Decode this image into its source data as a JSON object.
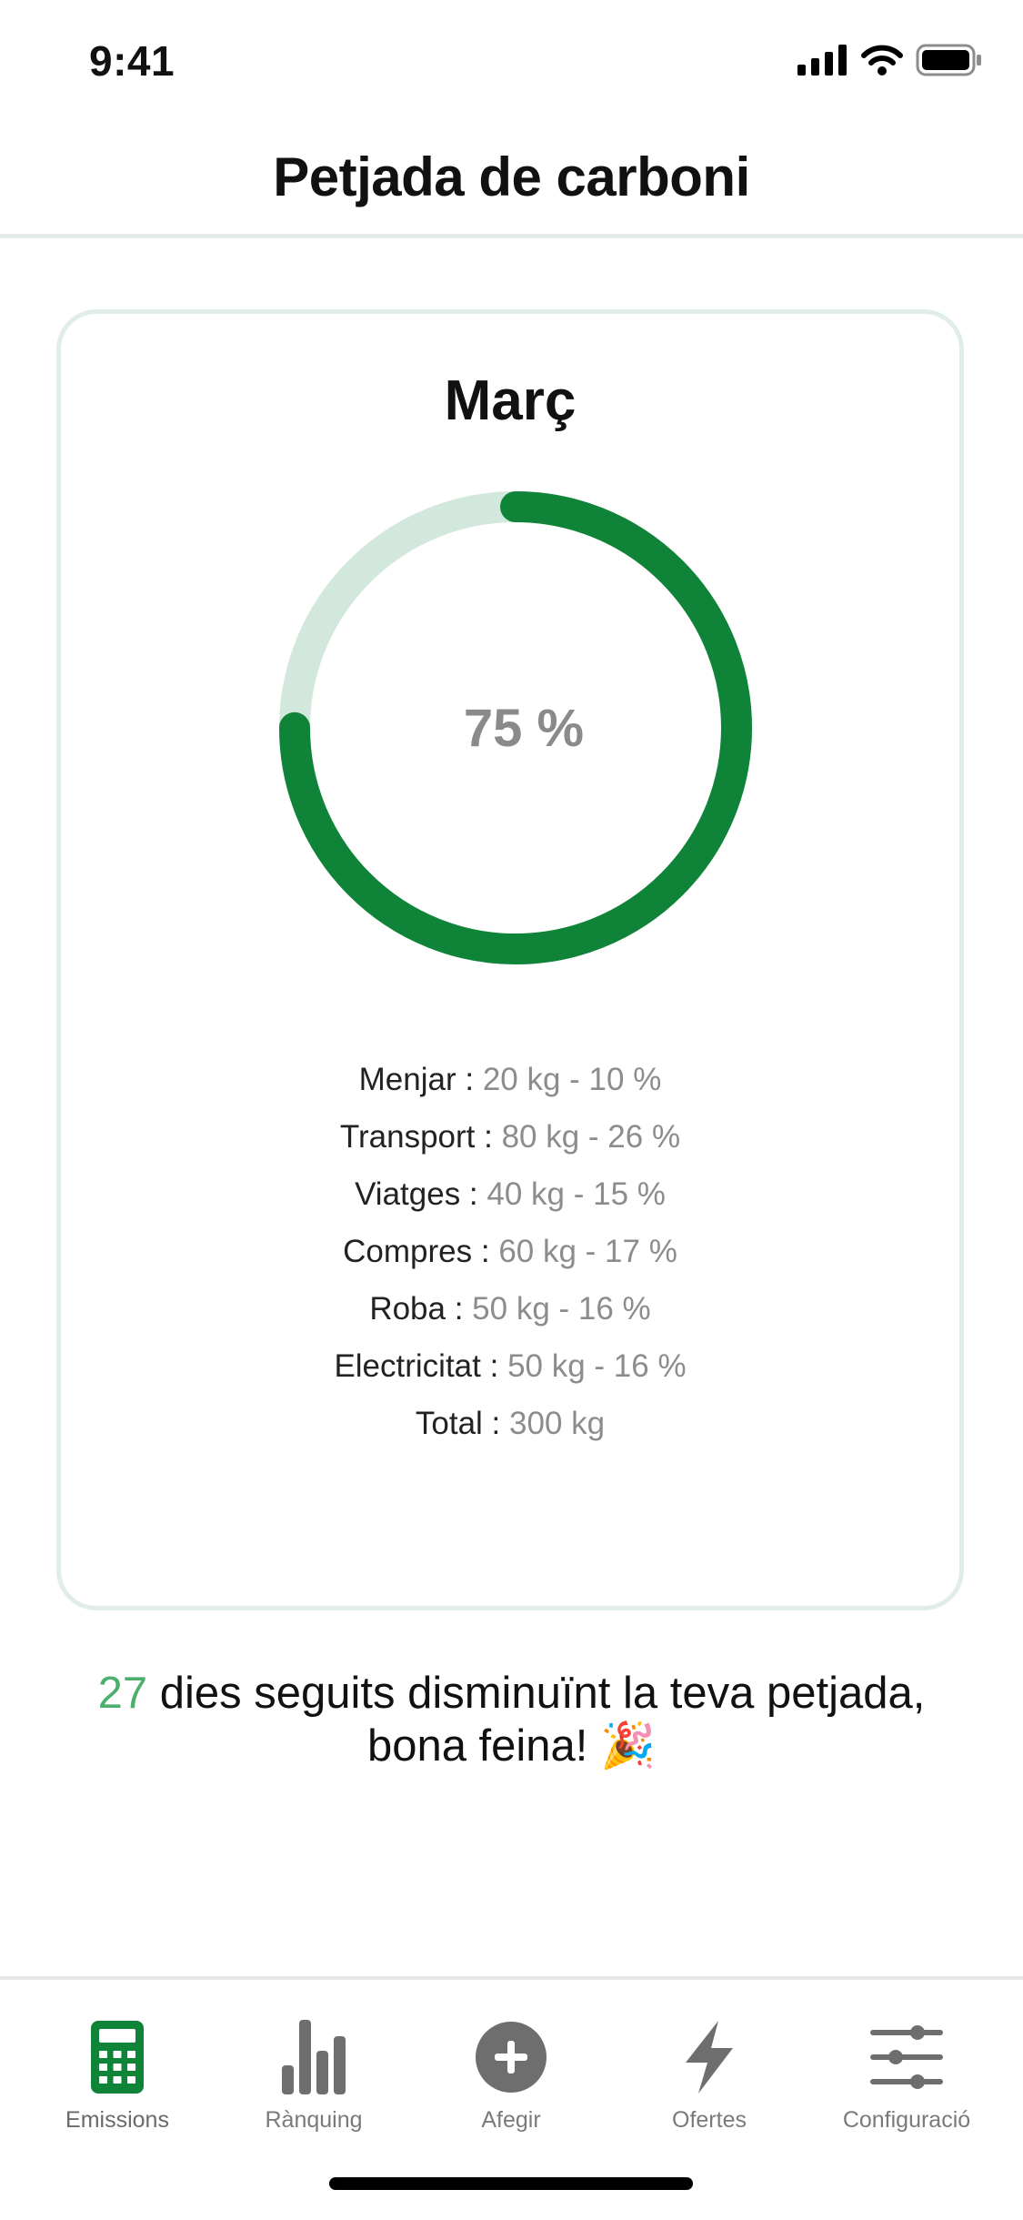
{
  "status_bar": {
    "time": "9:41"
  },
  "header": {
    "title": "Petjada de carboni"
  },
  "summary": {
    "month": "Març",
    "progress_label": "75 %",
    "progress_fraction": 0.75,
    "rows": [
      {
        "label": "Menjar :",
        "value": "20 kg - 10 %"
      },
      {
        "label": "Transport :",
        "value": "80 kg - 26 %"
      },
      {
        "label": "Viatges :",
        "value": "40 kg - 15 %"
      },
      {
        "label": "Compres :",
        "value": "60 kg - 17 %"
      },
      {
        "label": "Roba :",
        "value": "50 kg - 16 %"
      },
      {
        "label": "Electricitat :",
        "value": "50 kg - 16 %"
      },
      {
        "label": "Total :",
        "value": "300 kg"
      }
    ]
  },
  "streak": {
    "days": "27",
    "text_line1": " dies seguits disminuïnt la teva petjada,",
    "text_line2": "bona feina! ",
    "emoji": "🎉"
  },
  "tabs": [
    {
      "label": "Emissions",
      "icon": "calculator-icon",
      "active": true
    },
    {
      "label": "Rànquing",
      "icon": "bar-chart-icon",
      "active": false
    },
    {
      "label": "Afegir",
      "icon": "add-circle-icon",
      "active": false
    },
    {
      "label": "Ofertes",
      "icon": "lightning-icon",
      "active": false
    },
    {
      "label": "Configuració",
      "icon": "sliders-icon",
      "active": false
    }
  ],
  "colors": {
    "accent": "#0f8438",
    "ring_track": "#d2e8dc",
    "streak_number": "#4caf6c",
    "inactive_icon": "#6e6e6e",
    "muted_text": "#8c8c8c"
  }
}
